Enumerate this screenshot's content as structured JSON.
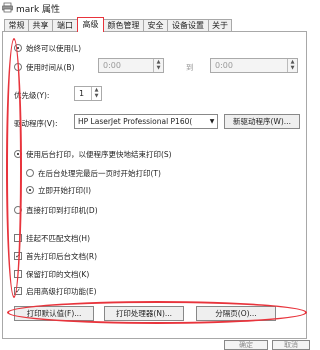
{
  "window": {
    "title": "mark 属性"
  },
  "tabs": [
    "常规",
    "共享",
    "端口",
    "高级",
    "颜色管理",
    "安全",
    "设备设置",
    "关于"
  ],
  "availability": {
    "always_label": "始终可以使用(L)",
    "from_label": "使用时间从(B)",
    "from_time": "0:00",
    "to_label": "到",
    "to_time": "0:00"
  },
  "priority": {
    "label": "优先级(Y):",
    "value": "1"
  },
  "driver": {
    "label": "驱动程序(V):",
    "value": "HP LaserJet Professional P160(",
    "new_button": "新驱动程序(W)..."
  },
  "spool": {
    "spool_label": "使用后台打印，以便程序更快地结束打印(S)",
    "after_last_label": "在后台处理完最后一页时开始打印(T)",
    "immediately_label": "立即开始打印(I)",
    "direct_label": "直接打印到打印机(D)"
  },
  "options": {
    "hold_mismatched": "挂起不匹配文档(H)",
    "spooled_first": "首先打印后台文档(R)",
    "keep_printed": "保留打印的文档(K)",
    "advanced_features": "启用高级打印功能(E)"
  },
  "buttons": {
    "defaults": "打印默认值(F)...",
    "processor": "打印处理器(N)...",
    "separator": "分隔页(O)..."
  },
  "dialog": {
    "ok": "确定",
    "cancel": "取消"
  },
  "annotation_color": "#e8343c"
}
